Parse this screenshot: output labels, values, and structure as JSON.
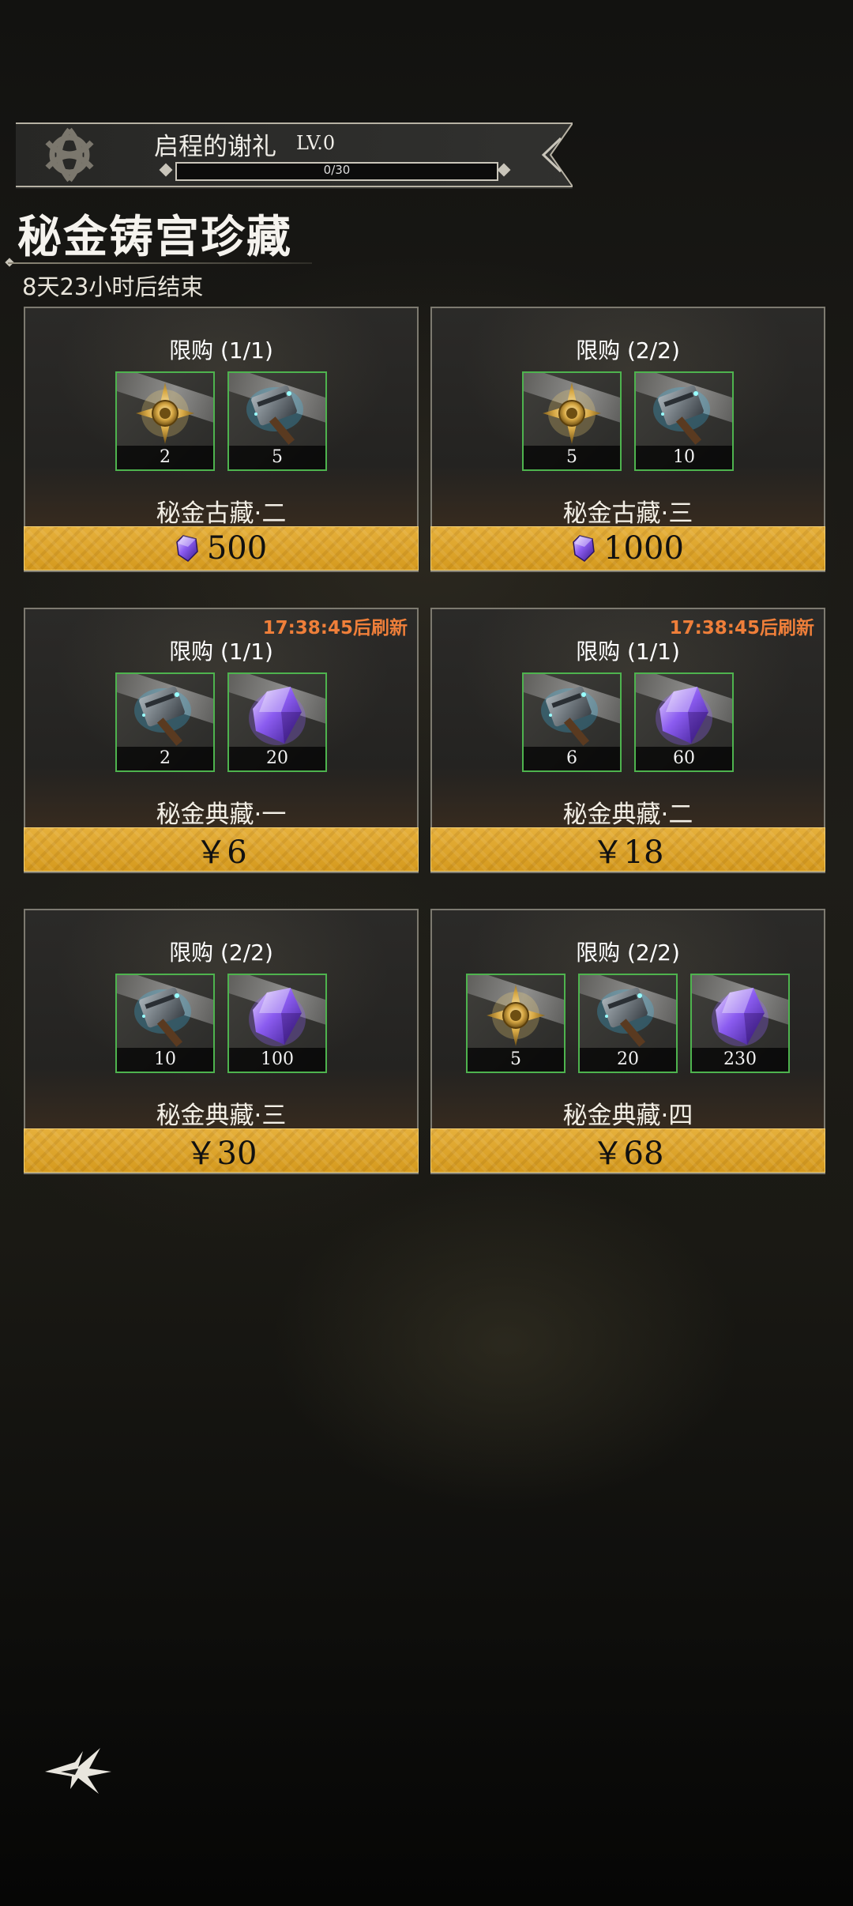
{
  "banner": {
    "title": "启程的谢礼",
    "level": "LV.0",
    "progress_text": "0/30",
    "progress": 0
  },
  "header": {
    "title": "秘金铸宫珍藏",
    "countdown": "8天23小时后结束"
  },
  "cards": [
    {
      "limit": "限购 (1/1)",
      "refresh": "",
      "name": "秘金古藏·二",
      "price": "500",
      "currency": "gem-icon",
      "items": [
        {
          "icon": "medal-icon",
          "count": "2"
        },
        {
          "icon": "hammer-icon",
          "count": "5"
        }
      ]
    },
    {
      "limit": "限购 (2/2)",
      "refresh": "",
      "name": "秘金古藏·三",
      "price": "1000",
      "currency": "gem-icon",
      "items": [
        {
          "icon": "medal-icon",
          "count": "5"
        },
        {
          "icon": "hammer-icon",
          "count": "10"
        }
      ]
    },
    {
      "limit": "限购 (1/1)",
      "refresh": "17:38:45后刷新",
      "name": "秘金典藏·一",
      "price": "￥6",
      "currency": "",
      "items": [
        {
          "icon": "hammer-icon",
          "count": "2"
        },
        {
          "icon": "crystal-icon",
          "count": "20"
        }
      ]
    },
    {
      "limit": "限购 (1/1)",
      "refresh": "17:38:45后刷新",
      "name": "秘金典藏·二",
      "price": "￥18",
      "currency": "",
      "items": [
        {
          "icon": "hammer-icon",
          "count": "6"
        },
        {
          "icon": "crystal-icon",
          "count": "60"
        }
      ]
    },
    {
      "limit": "限购 (2/2)",
      "refresh": "",
      "name": "秘金典藏·三",
      "price": "￥30",
      "currency": "",
      "items": [
        {
          "icon": "hammer-icon",
          "count": "10"
        },
        {
          "icon": "crystal-icon",
          "count": "100"
        }
      ]
    },
    {
      "limit": "限购 (2/2)",
      "refresh": "",
      "name": "秘金典藏·四",
      "price": "￥68",
      "currency": "",
      "items": [
        {
          "icon": "medal-icon",
          "count": "5"
        },
        {
          "icon": "hammer-icon",
          "count": "20"
        },
        {
          "icon": "crystal-icon",
          "count": "230"
        }
      ]
    }
  ],
  "colors": {
    "price_gold": "#dea52b",
    "item_border": "#4eb34e",
    "refresh_orange": "#ef7f3a"
  }
}
